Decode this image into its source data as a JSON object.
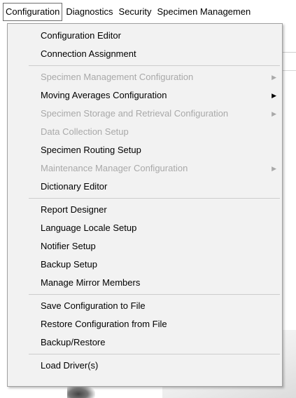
{
  "menubar": {
    "items": [
      "Configuration",
      "Diagnostics",
      "Security",
      "Specimen Managemen"
    ]
  },
  "menu": {
    "groups": [
      [
        {
          "label": "Configuration Editor",
          "enabled": true,
          "submenu": false
        },
        {
          "label": "Connection Assignment",
          "enabled": true,
          "submenu": false
        }
      ],
      [
        {
          "label": "Specimen Management Configuration",
          "enabled": false,
          "submenu": true
        },
        {
          "label": "Moving Averages Configuration",
          "enabled": true,
          "submenu": true
        },
        {
          "label": "Specimen Storage and Retrieval Configuration",
          "enabled": false,
          "submenu": true
        },
        {
          "label": "Data Collection Setup",
          "enabled": false,
          "submenu": false
        },
        {
          "label": "Specimen Routing Setup",
          "enabled": true,
          "submenu": false
        },
        {
          "label": "Maintenance Manager Configuration",
          "enabled": false,
          "submenu": true
        },
        {
          "label": "Dictionary Editor",
          "enabled": true,
          "submenu": false
        }
      ],
      [
        {
          "label": "Report Designer",
          "enabled": true,
          "submenu": false
        },
        {
          "label": "Language Locale Setup",
          "enabled": true,
          "submenu": false
        },
        {
          "label": "Notifier Setup",
          "enabled": true,
          "submenu": false
        },
        {
          "label": "Backup Setup",
          "enabled": true,
          "submenu": false
        },
        {
          "label": "Manage Mirror Members",
          "enabled": true,
          "submenu": false
        }
      ],
      [
        {
          "label": "Save Configuration to File",
          "enabled": true,
          "submenu": false
        },
        {
          "label": "Restore Configuration from File",
          "enabled": true,
          "submenu": false
        },
        {
          "label": "Backup/Restore",
          "enabled": true,
          "submenu": false
        }
      ],
      [
        {
          "label": "Load Driver(s)",
          "enabled": true,
          "submenu": false
        }
      ]
    ],
    "submenu_arrow_icon": "chevron-right-icon"
  }
}
